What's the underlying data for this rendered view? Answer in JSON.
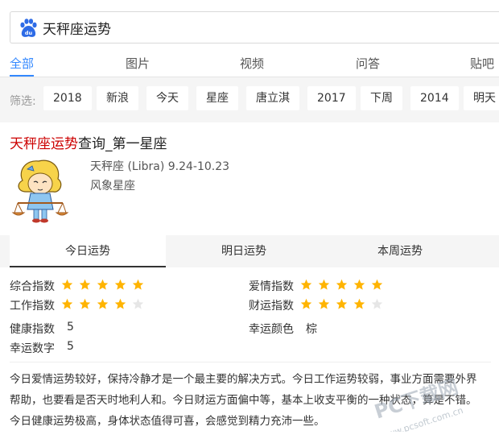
{
  "search": {
    "query": "天秤座运势"
  },
  "tabs": [
    "全部",
    "图片",
    "视频",
    "问答",
    "贴吧"
  ],
  "filter": {
    "label": "筛选:",
    "chips": [
      "2018",
      "新浪",
      "今天",
      "星座",
      "唐立淇",
      "2017",
      "下周",
      "2014",
      "明天"
    ]
  },
  "result": {
    "title_highlight": "天秤座运势",
    "title_rest": "查询_第一星座",
    "sign_line": "天秤座 (Libra) 9.24-10.23",
    "element_line": "风象星座"
  },
  "fortune_tabs": [
    "今日运势",
    "明日运势",
    "本周运势"
  ],
  "indices": {
    "overall": {
      "label": "综合指数",
      "stars": 5
    },
    "love": {
      "label": "爱情指数",
      "stars": 5
    },
    "work": {
      "label": "工作指数",
      "stars": 4
    },
    "wealth": {
      "label": "财运指数",
      "stars": 4
    },
    "health": {
      "label": "健康指数",
      "value": "5"
    },
    "color": {
      "label": "幸运颜色",
      "value": "棕"
    },
    "number": {
      "label": "幸运数字",
      "value": "5"
    }
  },
  "description": "今日爱情运势较好，保持冷静才是一个最主要的解决方式。今日工作运势较弱，事业方面需要外界帮助，也要看是否天时地利人和。今日财运方面偏中等，基本上收支平衡的一种状态，算是不错。今日健康运势极高，身体状态值得可喜，会感觉到精力充沛一些。",
  "watermark": {
    "brand": "PC下载网",
    "url": "www.pcsoft.com.cn"
  },
  "colors": {
    "accent": "#3388ff",
    "highlight": "#cc0000",
    "star_on": "#ffb400",
    "star_off": "#e6e6e6"
  }
}
